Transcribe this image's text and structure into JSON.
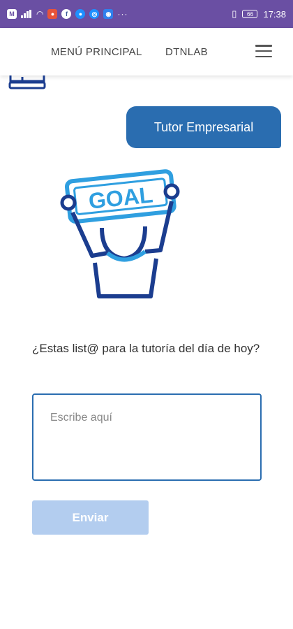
{
  "status_bar": {
    "time": "17:38",
    "battery_level": "66",
    "app_icon_label": "M",
    "more_indicator": "···"
  },
  "header": {
    "nav_main": "MENÚ PRINCIPAL",
    "nav_lab": "DTNLAB"
  },
  "chat": {
    "bot_bubble": "Tutor Empresarial"
  },
  "illustration": {
    "sign_text": "GOAL"
  },
  "form": {
    "question": "¿Estas list@ para la tutoría del día de hoy?",
    "input_placeholder": "Escribe aquí",
    "input_value": "",
    "send_label": "Enviar"
  },
  "colors": {
    "status_bar": "#6a4fa3",
    "primary": "#2a6db0",
    "button_disabled": "#b3cdef",
    "illustration_light": "#2f9fe0",
    "illustration_dark": "#1b3d8f"
  }
}
